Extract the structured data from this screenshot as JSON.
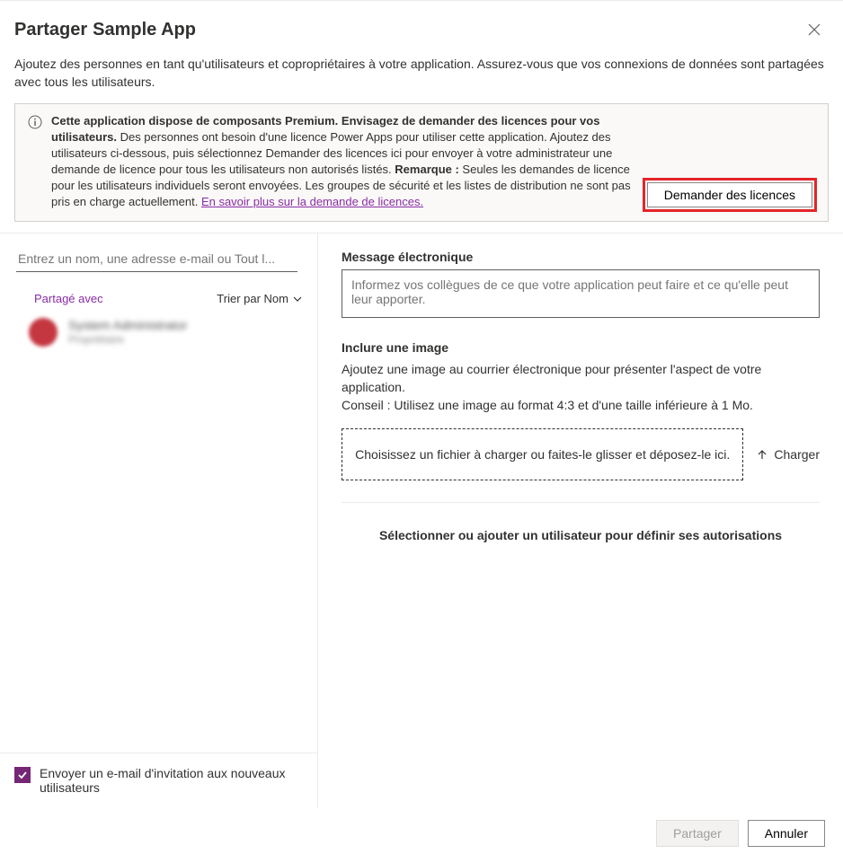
{
  "header": {
    "title_prefix": "Partager",
    "title_app": "Sample App",
    "subtitle": "Ajoutez des personnes en tant qu'utilisateurs et copropriétaires à votre application. Assurez-vous que vos connexions de données sont partagées avec tous les utilisateurs."
  },
  "info": {
    "bold1": "Cette application dispose de composants Premium. Envisagez de demander des licences pour vos utilisateurs.",
    "text1": " Des personnes ont besoin d'une licence Power Apps pour utiliser cette application. Ajoutez des utilisateurs ci-dessous, puis sélectionnez Demander des licences ici pour envoyer à votre administrateur une demande de licence pour tous les utilisateurs non autorisés listés. ",
    "bold2": "Remarque :",
    "text2": " Seules les demandes de licence pour les utilisateurs individuels seront envoyées. Les groupes de sécurité et les listes de distribution ne sont pas pris en charge actuellement. ",
    "link": "En savoir plus sur la demande de licences.",
    "button": "Demander des licences"
  },
  "left": {
    "placeholder": "Entrez un nom, une adresse e-mail ou Tout l...",
    "shared_with": "Partagé avec",
    "sort_by": "Trier par Nom",
    "user": {
      "name": "System Administrator",
      "role": "Propriétaire"
    },
    "invite_checkbox": "Envoyer un e-mail d'invitation aux nouveaux utilisateurs"
  },
  "right": {
    "email_label": "Message électronique",
    "email_placeholder": "Informez vos collègues de ce que votre application peut faire et ce qu'elle peut leur apporter.",
    "image_label": "Inclure une image",
    "image_desc": "Ajoutez une image au courrier électronique pour présenter l'aspect de votre application.",
    "image_tip": "Conseil : Utilisez une image au format 4:3 et d'une taille inférieure à 1 Mo.",
    "dropzone": "Choisissez un fichier à charger ou faites-le glisser et déposez-le ici.",
    "upload": "Charger",
    "select_user": "Sélectionner ou ajouter un utilisateur pour définir ses autorisations"
  },
  "footer": {
    "share": "Partager",
    "cancel": "Annuler"
  }
}
